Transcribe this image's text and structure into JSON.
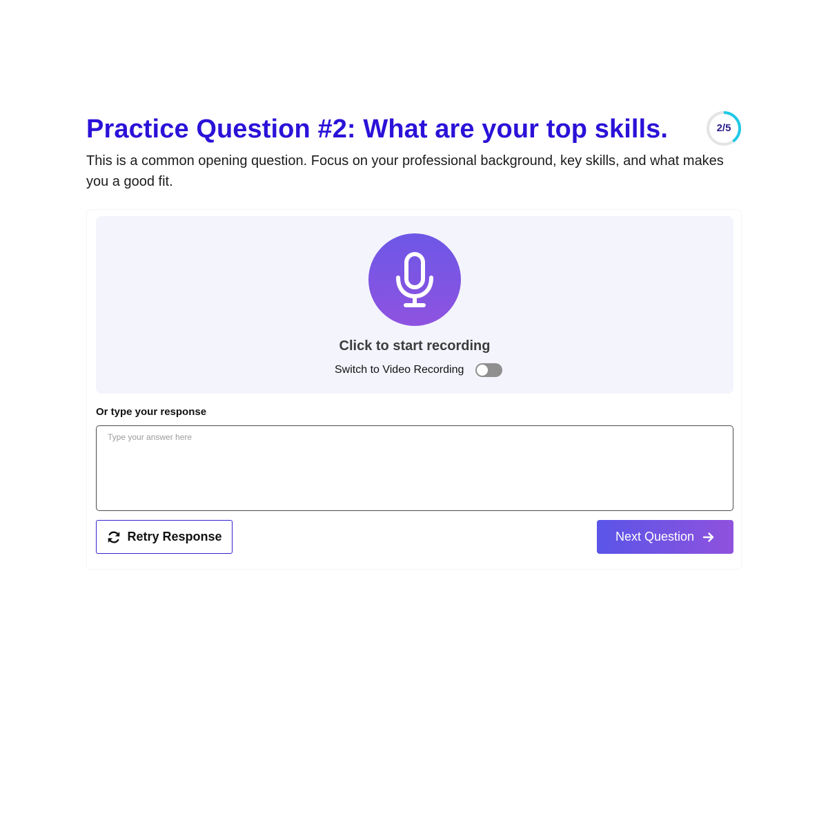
{
  "question": {
    "title": "Practice Question #2: What are your top skills.",
    "description": "This is a common opening question. Focus on your professional background, key skills, and what makes you a good fit."
  },
  "progress": {
    "label": "2/5",
    "current": 2,
    "total": 5,
    "ring_color": "#1ec8e6",
    "track_color": "#e4e4e4"
  },
  "recorder": {
    "mic_icon": "microphone-icon",
    "prompt": "Click to start recording",
    "video_toggle_label": "Switch to Video Recording",
    "video_toggle_on": false
  },
  "response": {
    "label": "Or type your response",
    "placeholder": "Type your answer here",
    "value": ""
  },
  "actions": {
    "retry_label": "Retry Response",
    "retry_icon": "refresh-icon",
    "next_label": "Next Question",
    "next_icon": "arrow-right-icon"
  },
  "colors": {
    "title": "#2a12d8",
    "accent_start": "#5a55e8",
    "accent_end": "#8f52dd",
    "panel_bg": "#f3f4fc"
  }
}
